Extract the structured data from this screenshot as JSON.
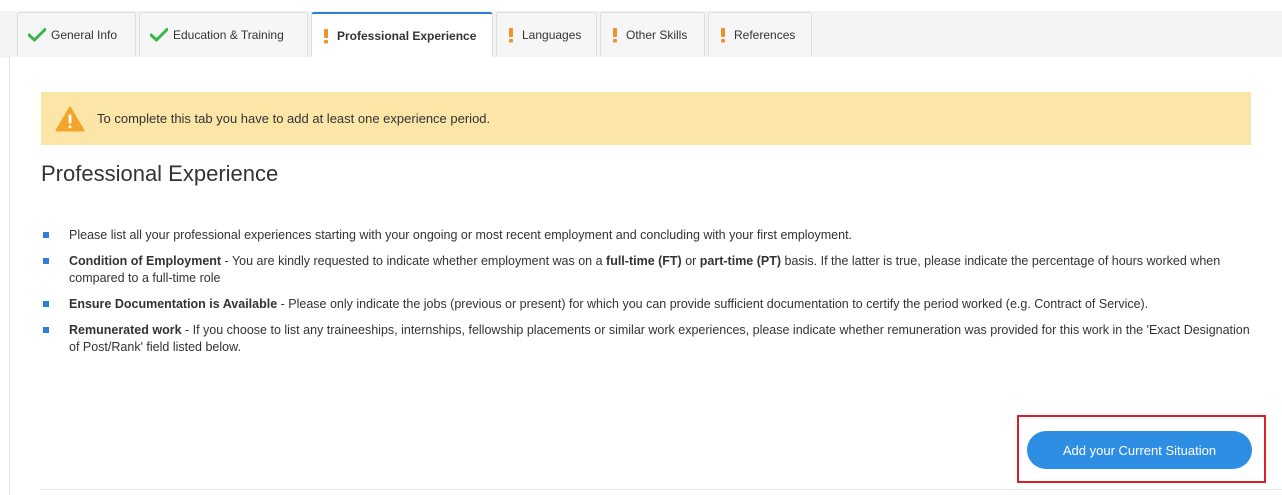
{
  "tabs": [
    {
      "label": "General Info",
      "status": "complete"
    },
    {
      "label": "Education & Training",
      "status": "complete"
    },
    {
      "label": "Professional Experience",
      "status": "incomplete",
      "active": true
    },
    {
      "label": "Languages",
      "status": "incomplete"
    },
    {
      "label": "Other Skills",
      "status": "incomplete"
    },
    {
      "label": "References",
      "status": "incomplete"
    }
  ],
  "alert": {
    "icon": "warning-icon",
    "text": "To complete this tab you have to add at least one experience period."
  },
  "section": {
    "title": "Professional Experience"
  },
  "bullets": [
    {
      "plain": "Please list all your professional experiences starting with your ongoing or most recent employment and concluding with your first employment."
    },
    {
      "term": "Condition of Employment",
      "t1": " - You are kindly requested to indicate whether employment was on a ",
      "b1": "full-time (FT)",
      "t2": " or ",
      "b2": "part-time (PT)",
      "t3": " basis. If the latter is true, please indicate the percentage of hours worked when compared to a full-time role"
    },
    {
      "term": "Ensure Documentation is Available",
      "text": " - Please only indicate the jobs (previous or present) for which you can provide sufficient documentation to certify the period worked (e.g. Contract of Service)."
    },
    {
      "term": "Remunerated work",
      "text": " - If you choose to list any traineeships, internships, fellowship placements or similar work experiences, please indicate whether remuneration was provided for this work in the 'Exact Designation of Post/Rank' field listed below."
    }
  ],
  "add_button": {
    "label": "Add your Current Situation"
  },
  "colors": {
    "complete": "#3ab54a",
    "incomplete": "#f0902a",
    "accent": "#2e8ee4",
    "alert_bg": "#fbe6a8",
    "highlight": "#dc1f26"
  }
}
